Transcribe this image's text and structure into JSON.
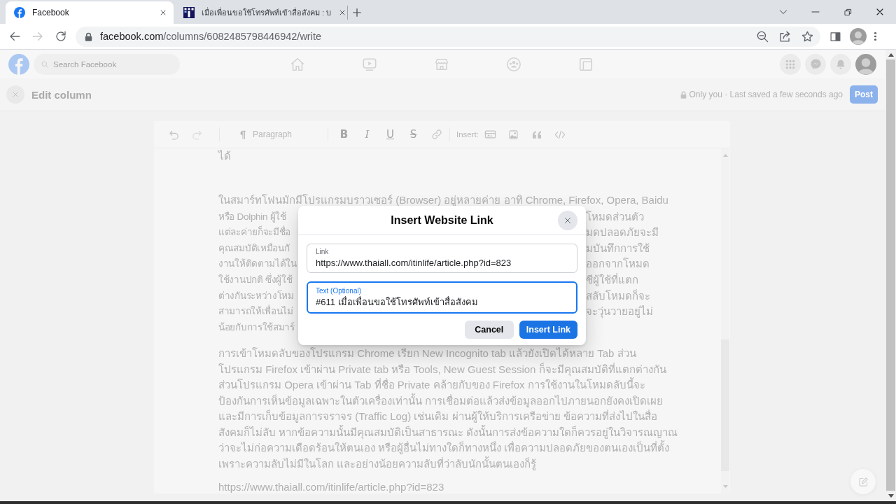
{
  "browser": {
    "tabs": [
      {
        "title": "Facebook",
        "selected": true
      },
      {
        "title": "เมื่อเพื่อนขอใช้โทรศัพท์เข้าสื่อสังคม : บ",
        "selected": false
      }
    ],
    "back_button": {
      "disabled": false
    },
    "forward_button": {
      "disabled": true
    },
    "address_bar": {
      "host": "facebook.com",
      "path": "/columns/6082485798446942/write"
    }
  },
  "site_header": {
    "search": {
      "placeholder": "Search Facebook"
    }
  },
  "column_bar": {
    "title": "Edit column",
    "status": "Only you · Last saved a few seconds ago",
    "post_button": "Post"
  },
  "editor": {
    "toolbar": {
      "undo": {
        "disabled": false
      },
      "redo": {
        "disabled": true
      },
      "block_type": "Paragraph",
      "format_buttons": [
        {
          "label": "B",
          "kind": "bold"
        },
        {
          "label": "I",
          "kind": "italic"
        },
        {
          "label": "U",
          "kind": "underline"
        },
        {
          "label": "S",
          "kind": "strike"
        }
      ],
      "insert_label": "Insert:"
    },
    "blocks": [
      {
        "kind": "paragraph",
        "lines": [
          "ได้"
        ]
      },
      {
        "kind": "empty"
      },
      {
        "kind": "covered_paragraph",
        "first_line": "ในสมาร์ทโฟนมักมีโปรแกรมบราวเซอร์ (Browser) อยู่หลายค่าย อาทิ Chrome, Firefox, Opera, Baidu",
        "left_parts": [
          "หรือ Dolphin ผู้ใช้",
          "แต่ละค่ายก็จะมีชื่อ",
          "คุณสมบัติเหมือนกั",
          "งานให้ติดตามได้ใน",
          "ใช้งานปกติ ซึ่งผู้ใช้",
          "ต่างกันระหว่างโหม",
          "สามารถให้เพื่อนไม่",
          "น้อยกับการใช้สมาร์"
        ],
        "right_parts": [
          "โหมดส่วนตัว",
          "มดปลอดภัยจะมี",
          "มบันทึกการใช้",
          "ออกจากโหมด",
          "ชีผู้ใช้ที่แตก",
          "สลับโหมดก็จะ",
          "จะวุ่นวายอยู่ไม่"
        ]
      },
      {
        "kind": "paragraph",
        "lines": [
          "การเข้าโหมดลับของโปรแกรม Chrome เรียก New Incognito tab แล้วยังเปิดได้หลาย Tab ส่วน",
          "โปรแกรม Firefox เข้าผ่าน Private tab หรือ Tools, New Guest Session ก็จะมีคุณสมบัติที่แตกต่างกัน",
          "ส่วนโปรแกรม Opera เข้าผ่าน Tab ที่ชื่อ Private คล้ายกับของ Firefox การใช้งานในโหมดลับนี้จะ",
          "ป้องกันการเห็นข้อมูลเฉพาะในตัวเครื่องเท่านั้น การเชื่อมต่อแล้วส่งข้อมูลออกไปภายนอกยังคงเปิดเผย",
          "และมีการเก็บข้อมูลการจราจร (Traffic Log) เช่นเดิม ผ่านผู้ให้บริการเครือข่าย ข้อความที่ส่งไปในสื่อ",
          "สังคมก็ไม่ลับ หากข้อความนั้นมีคุณสมบัติเป็นสาธารณะ ดังนั้นการส่งข้อความใดก็ควรอยู่ในวิจารณญาณ",
          "ว่าจะไม่ก่อความเดือดร้อนให้ตนเอง หรือผู้อื่นไม่ทางใดก็ทางหนึ่ง เพื่อความปลอดภัยของตนเองเป็นที่ตั้ง",
          "เพราะความลับไม่มีในโลก และอย่างน้อยความลับที่ว่าลับนักนั้นตนเองก็รู้"
        ]
      },
      {
        "kind": "paragraph",
        "lines": [
          "https://www.thaiall.com/itinlife/article.php?id=823"
        ]
      }
    ]
  },
  "dialog": {
    "title": "Insert Website Link",
    "fields": [
      {
        "label": "Link",
        "value": "https://www.thaiall.com/itinlife/article.php?id=823",
        "focused": false
      },
      {
        "label": "Text (Optional)",
        "value": "#611 เมื่อเพื่อนขอใช้โทรศัพท์เข้าสื่อสังคม",
        "focused": true
      }
    ],
    "buttons": [
      {
        "label": "Cancel",
        "kind": "secondary"
      },
      {
        "label": "Insert Link",
        "kind": "primary"
      }
    ]
  }
}
